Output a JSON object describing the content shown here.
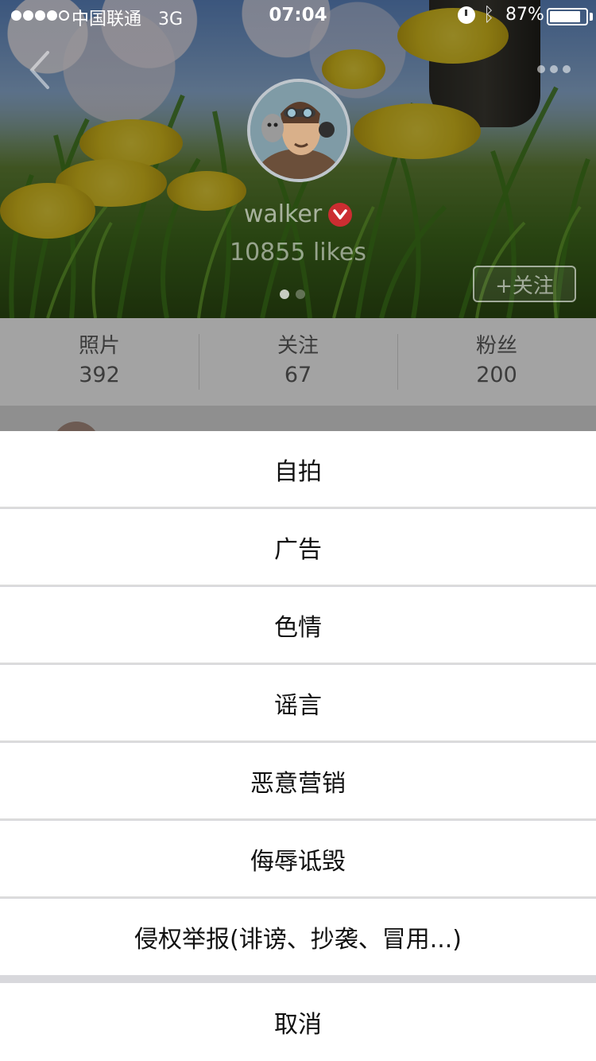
{
  "status_bar": {
    "carrier": "中国联通",
    "network": "3G",
    "time": "07:04",
    "battery_percent": "87%",
    "battery_level": 0.87,
    "signal_bars_filled": 4,
    "signal_bars_total": 5
  },
  "header": {
    "back_icon": "chevron-left-icon",
    "more_icon": "more-dots-icon",
    "username": "walker",
    "verified_icon": "verified-badge-icon",
    "likes_text": "10855 likes",
    "follow_label": "+关注",
    "pager": {
      "pages": 2,
      "active": 1
    }
  },
  "stats": [
    {
      "label": "照片",
      "value": "392"
    },
    {
      "label": "关注",
      "value": "67"
    },
    {
      "label": "粉丝",
      "value": "200"
    }
  ],
  "action_sheet": {
    "items": [
      "自拍",
      "广告",
      "色情",
      "谣言",
      "恶意营销",
      "侮辱诋毁",
      "侵权举报(诽谤、抄袭、冒用...)"
    ],
    "cancel_label": "取消"
  },
  "colors": {
    "verified_badge": "#cc2d31",
    "stats_background": "#a3a3a3",
    "sheet_separator": "#d8d8dc"
  }
}
